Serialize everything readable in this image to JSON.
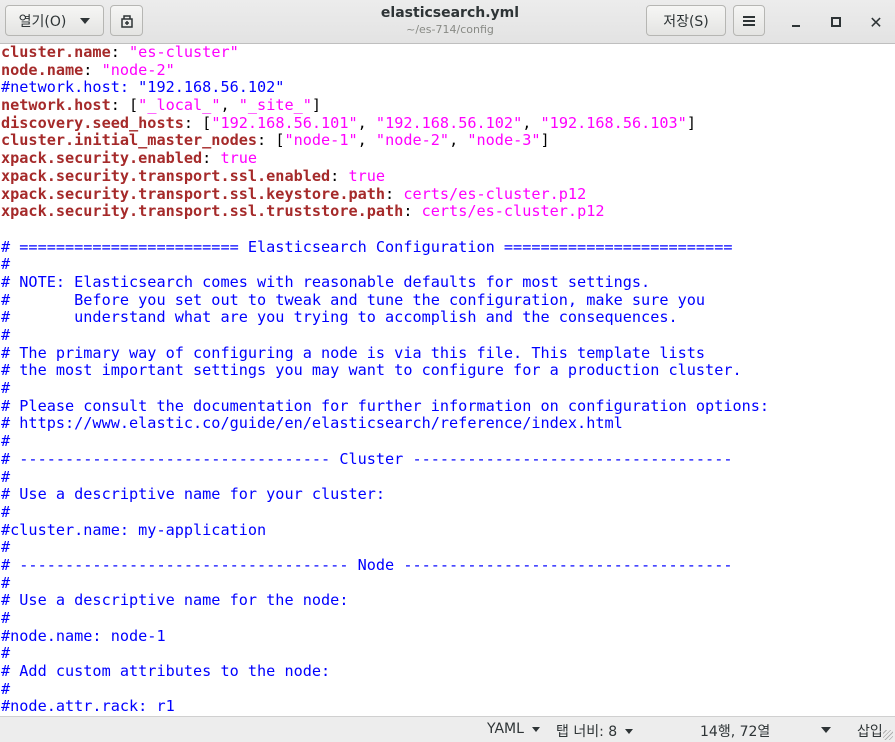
{
  "header": {
    "open_label": "열기(O)",
    "save_label": "저장(S)",
    "title": "elasticsearch.yml",
    "subtitle": "~/es-714/config"
  },
  "editor": {
    "lines": [
      [
        {
          "t": "k",
          "v": "cluster.name"
        },
        {
          "t": "p",
          "v": ": "
        },
        {
          "t": "s",
          "v": "\"es-cluster\""
        }
      ],
      [
        {
          "t": "k",
          "v": "node.name"
        },
        {
          "t": "p",
          "v": ": "
        },
        {
          "t": "s",
          "v": "\"node-2\""
        }
      ],
      [
        {
          "t": "c",
          "v": "#network.host: \"192.168.56.102\""
        }
      ],
      [
        {
          "t": "k",
          "v": "network.host"
        },
        {
          "t": "p",
          "v": ": ["
        },
        {
          "t": "s",
          "v": "\"_local_\""
        },
        {
          "t": "p",
          "v": ", "
        },
        {
          "t": "s",
          "v": "\"_site_\""
        },
        {
          "t": "p",
          "v": "]"
        }
      ],
      [
        {
          "t": "k",
          "v": "discovery.seed_hosts"
        },
        {
          "t": "p",
          "v": ": ["
        },
        {
          "t": "s",
          "v": "\"192.168.56.101\""
        },
        {
          "t": "p",
          "v": ", "
        },
        {
          "t": "s",
          "v": "\"192.168.56.102\""
        },
        {
          "t": "p",
          "v": ", "
        },
        {
          "t": "s",
          "v": "\"192.168.56.103\""
        },
        {
          "t": "p",
          "v": "]"
        }
      ],
      [
        {
          "t": "k",
          "v": "cluster.initial_master_nodes"
        },
        {
          "t": "p",
          "v": ": ["
        },
        {
          "t": "s",
          "v": "\"node-1\""
        },
        {
          "t": "p",
          "v": ", "
        },
        {
          "t": "s",
          "v": "\"node-2\""
        },
        {
          "t": "p",
          "v": ", "
        },
        {
          "t": "s",
          "v": "\"node-3\""
        },
        {
          "t": "p",
          "v": "]"
        }
      ],
      [
        {
          "t": "k",
          "v": "xpack.security.enabled"
        },
        {
          "t": "p",
          "v": ": "
        },
        {
          "t": "s",
          "v": "true"
        }
      ],
      [
        {
          "t": "k",
          "v": "xpack.security.transport.ssl.enabled"
        },
        {
          "t": "p",
          "v": ": "
        },
        {
          "t": "s",
          "v": "true"
        }
      ],
      [
        {
          "t": "k",
          "v": "xpack.security.transport.ssl.keystore.path"
        },
        {
          "t": "p",
          "v": ": "
        },
        {
          "t": "s",
          "v": "certs/es-cluster.p12"
        }
      ],
      [
        {
          "t": "k",
          "v": "xpack.security.transport.ssl.truststore.path"
        },
        {
          "t": "p",
          "v": ": "
        },
        {
          "t": "s",
          "v": "certs/es-cluster.p12"
        }
      ],
      [],
      [
        {
          "t": "c",
          "v": "# ======================== Elasticsearch Configuration ========================="
        }
      ],
      [
        {
          "t": "c",
          "v": "#"
        }
      ],
      [
        {
          "t": "c",
          "v": "# NOTE: Elasticsearch comes with reasonable defaults for most settings."
        }
      ],
      [
        {
          "t": "c",
          "v": "#       Before you set out to tweak and tune the configuration, make sure you"
        }
      ],
      [
        {
          "t": "c",
          "v": "#       understand what are you trying to accomplish and the consequences."
        }
      ],
      [
        {
          "t": "c",
          "v": "#"
        }
      ],
      [
        {
          "t": "c",
          "v": "# The primary way of configuring a node is via this file. This template lists"
        }
      ],
      [
        {
          "t": "c",
          "v": "# the most important settings you may want to configure for a production cluster."
        }
      ],
      [
        {
          "t": "c",
          "v": "#"
        }
      ],
      [
        {
          "t": "c",
          "v": "# Please consult the documentation for further information on configuration options:"
        }
      ],
      [
        {
          "t": "c",
          "v": "# https://www.elastic.co/guide/en/elasticsearch/reference/index.html"
        }
      ],
      [
        {
          "t": "c",
          "v": "#"
        }
      ],
      [
        {
          "t": "c",
          "v": "# ---------------------------------- Cluster -----------------------------------"
        }
      ],
      [
        {
          "t": "c",
          "v": "#"
        }
      ],
      [
        {
          "t": "c",
          "v": "# Use a descriptive name for your cluster:"
        }
      ],
      [
        {
          "t": "c",
          "v": "#"
        }
      ],
      [
        {
          "t": "c",
          "v": "#cluster.name: my-application"
        }
      ],
      [
        {
          "t": "c",
          "v": "#"
        }
      ],
      [
        {
          "t": "c",
          "v": "# ------------------------------------ Node ------------------------------------"
        }
      ],
      [
        {
          "t": "c",
          "v": "#"
        }
      ],
      [
        {
          "t": "c",
          "v": "# Use a descriptive name for the node:"
        }
      ],
      [
        {
          "t": "c",
          "v": "#"
        }
      ],
      [
        {
          "t": "c",
          "v": "#node.name: node-1"
        }
      ],
      [
        {
          "t": "c",
          "v": "#"
        }
      ],
      [
        {
          "t": "c",
          "v": "# Add custom attributes to the node:"
        }
      ],
      [
        {
          "t": "c",
          "v": "#"
        }
      ],
      [
        {
          "t": "c",
          "v": "#node.attr.rack: r1"
        }
      ]
    ]
  },
  "statusbar": {
    "language": "YAML",
    "tab_width": "탭 너비: 8",
    "position": "14행, 72열",
    "mode": "삽입"
  }
}
